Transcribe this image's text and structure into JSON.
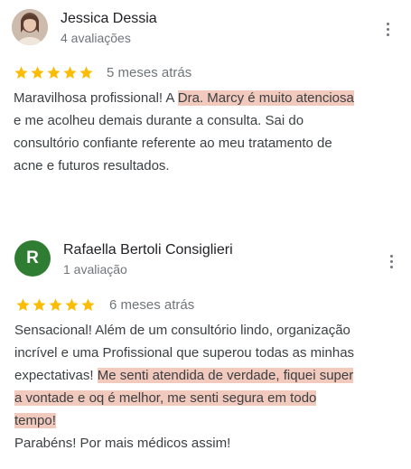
{
  "colors": {
    "star": "#fbbc04",
    "highlight": "#f2c9bd",
    "avatar_letter_bg": "#2e7d32"
  },
  "reviews": [
    {
      "author": "Jessica Dessia",
      "review_count": "4 avaliações",
      "avatar": "photo",
      "rating": 5,
      "date": "5 meses atrás",
      "text_lines": [
        {
          "plain": "Maravilhosa profissional! A ",
          "highlight": "Dra. Marcy é muito atenciosa",
          "after": ""
        },
        {
          "plain": "e me acolheu demais durante a consulta. Sai do",
          "highlight": "",
          "after": ""
        },
        {
          "plain": "consultório confiante referente ao meu tratamento de",
          "highlight": "",
          "after": ""
        },
        {
          "plain": "acne e futuros resultados.",
          "highlight": "",
          "after": ""
        }
      ]
    },
    {
      "author": "Rafaella Bertoli Consiglieri",
      "review_count": "1 avaliação",
      "avatar": "R",
      "rating": 5,
      "date": "6 meses atrás",
      "text_lines": [
        {
          "plain": "Sensacional! Além de um consultório lindo, organização",
          "highlight": "",
          "after": ""
        },
        {
          "plain": "incrível e uma Profissional que superou todas as minhas",
          "highlight": "",
          "after": ""
        },
        {
          "plain": "expectativas! ",
          "highlight": "Me senti atendida de verdade, fiquei super",
          "after": ""
        },
        {
          "plain": "",
          "highlight": "a vontade e oq é melhor, me senti segura em todo",
          "after": ""
        },
        {
          "plain": "",
          "highlight": "tempo!",
          "after": ""
        },
        {
          "plain": "Parabéns! Por mais médicos assim!",
          "highlight": "",
          "after": ""
        }
      ]
    }
  ]
}
